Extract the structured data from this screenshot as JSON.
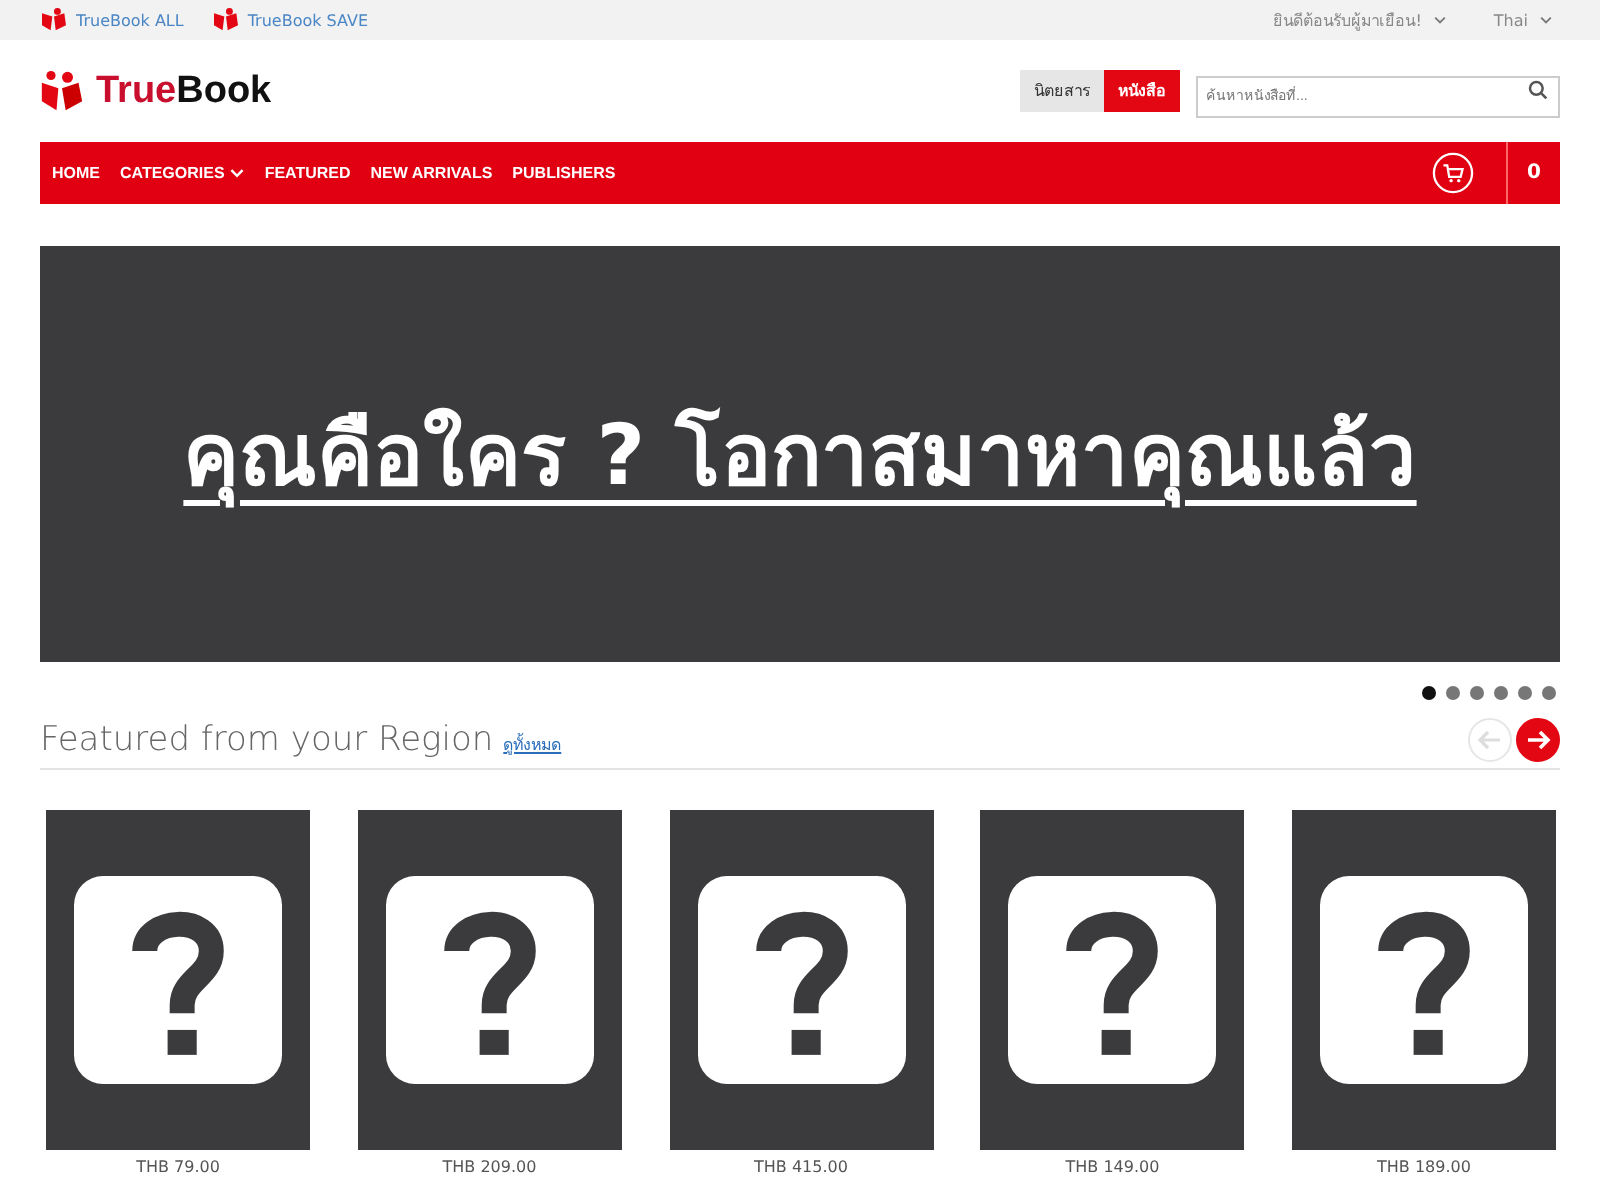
{
  "top_bar": {
    "links": [
      "TrueBook ALL",
      "TrueBook SAVE"
    ],
    "welcome": "ยินดีต้อนรับผู้มาเยือน!",
    "language": "Thai"
  },
  "header": {
    "logo": {
      "part1": "True",
      "part2": "Book"
    },
    "tabs": [
      {
        "label": "นิตยสาร",
        "selected": false
      },
      {
        "label": "หนังสือ",
        "selected": true
      }
    ],
    "search": {
      "placeholder": "ค้นหาหนังสือที่..."
    }
  },
  "nav": {
    "items": [
      {
        "label": "HOME",
        "dropdown": false
      },
      {
        "label": "CATEGORIES",
        "dropdown": true
      },
      {
        "label": "FEATURED",
        "dropdown": false
      },
      {
        "label": "NEW ARRIVALS",
        "dropdown": false
      },
      {
        "label": "PUBLISHERS",
        "dropdown": false
      }
    ],
    "cart_count": "0"
  },
  "banner": {
    "text": "คุณคือใคร ? โอกาสมาหาคุณแล้ว",
    "dots": [
      {
        "selected": true
      },
      {
        "selected": false
      },
      {
        "selected": false
      },
      {
        "selected": false
      },
      {
        "selected": false
      },
      {
        "selected": false
      }
    ]
  },
  "featured": {
    "title": "Featured from your Region",
    "see_all": "ดูทั้งหมด",
    "prev_disabled": true,
    "next_disabled": false,
    "products": [
      {
        "price": "THB 79.00"
      },
      {
        "price": "THB 209.00"
      },
      {
        "price": "THB 415.00"
      },
      {
        "price": "THB 149.00"
      },
      {
        "price": "THB 189.00"
      }
    ]
  }
}
